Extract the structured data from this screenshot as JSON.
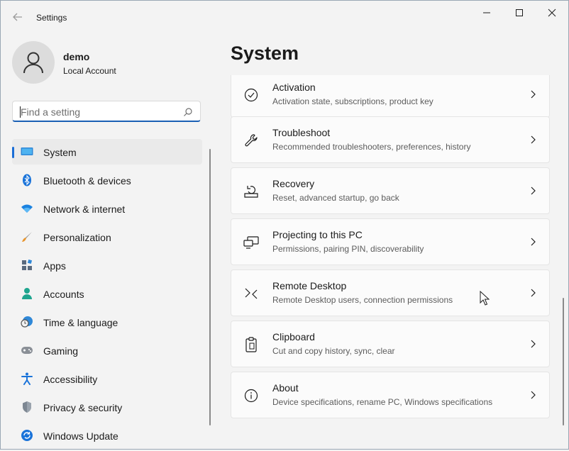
{
  "window": {
    "title": "Settings"
  },
  "profile": {
    "name": "demo",
    "account_type": "Local Account"
  },
  "search": {
    "placeholder": "Find a setting",
    "value": ""
  },
  "nav": {
    "items": [
      {
        "label": "System",
        "icon": "display-icon",
        "selected": true
      },
      {
        "label": "Bluetooth & devices",
        "icon": "bluetooth-icon"
      },
      {
        "label": "Network & internet",
        "icon": "wifi-icon"
      },
      {
        "label": "Personalization",
        "icon": "brush-icon"
      },
      {
        "label": "Apps",
        "icon": "apps-icon"
      },
      {
        "label": "Accounts",
        "icon": "person-icon"
      },
      {
        "label": "Time & language",
        "icon": "clock-globe-icon"
      },
      {
        "label": "Gaming",
        "icon": "gamepad-icon"
      },
      {
        "label": "Accessibility",
        "icon": "accessibility-icon"
      },
      {
        "label": "Privacy & security",
        "icon": "shield-icon"
      },
      {
        "label": "Windows Update",
        "icon": "update-icon"
      }
    ]
  },
  "main": {
    "title": "System",
    "cards": [
      {
        "title": "Activation",
        "description": "Activation state, subscriptions, product key",
        "icon": "check-circle-icon"
      },
      {
        "title": "Troubleshoot",
        "description": "Recommended troubleshooters, preferences, history",
        "icon": "wrench-icon"
      },
      {
        "title": "Recovery",
        "description": "Reset, advanced startup, go back",
        "icon": "recovery-icon"
      },
      {
        "title": "Projecting to this PC",
        "description": "Permissions, pairing PIN, discoverability",
        "icon": "projection-icon"
      },
      {
        "title": "Remote Desktop",
        "description": "Remote Desktop users, connection permissions",
        "icon": "remote-desktop-icon"
      },
      {
        "title": "Clipboard",
        "description": "Cut and copy history, sync, clear",
        "icon": "clipboard-icon"
      },
      {
        "title": "About",
        "description": "Device specifications, rename PC, Windows specifications",
        "icon": "info-icon"
      }
    ]
  },
  "colors": {
    "accent": "#1a6dd6",
    "background": "#f3f3f3",
    "card": "#fbfbfb"
  }
}
